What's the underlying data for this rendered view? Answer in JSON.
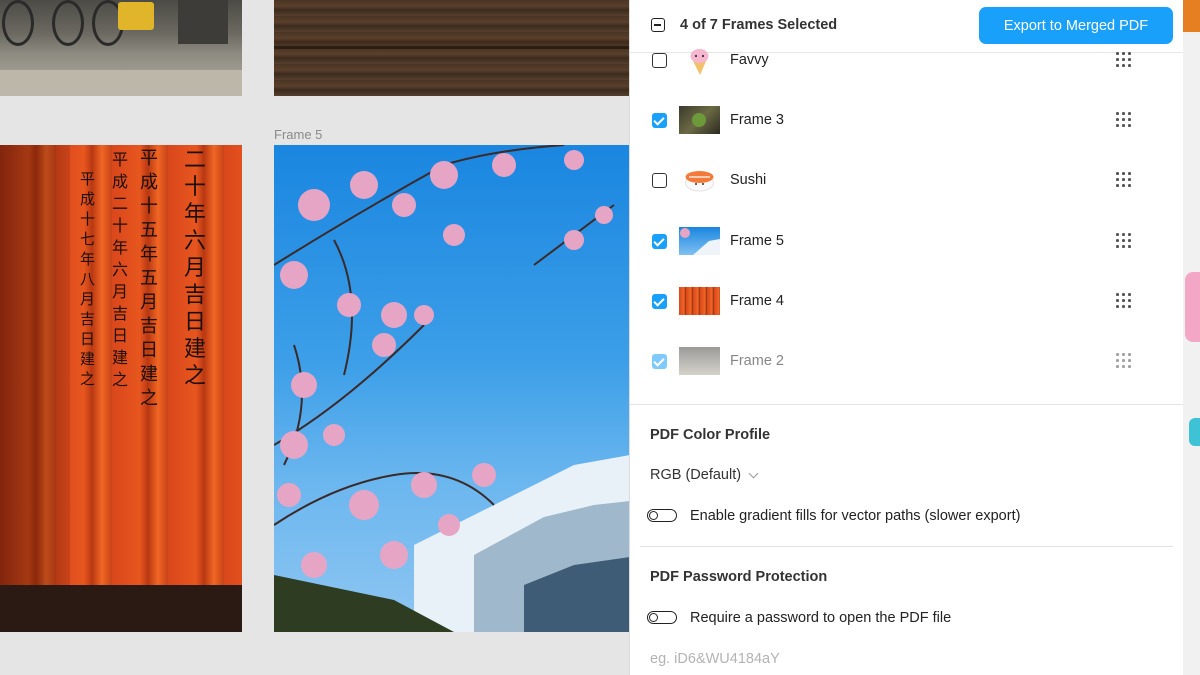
{
  "canvas": {
    "frame5_label": "Frame 5",
    "torii_columns": [
      "平成十七年八月吉日建之",
      "平成二十年六月吉日建之",
      "平成十五年五月吉日建之",
      "二十年六月吉日建之"
    ]
  },
  "panel": {
    "header": {
      "title": "4 of 7 Frames Selected",
      "export_label": "Export to Merged PDF"
    },
    "frames": [
      {
        "label": "Favvy",
        "checked": false,
        "thumb": "ice-cream-icon"
      },
      {
        "label": "Frame 3",
        "checked": true,
        "thumb": "matcha-photo"
      },
      {
        "label": "Sushi",
        "checked": false,
        "thumb": "sushi-icon"
      },
      {
        "label": "Frame 5",
        "checked": true,
        "thumb": "fuji-photo"
      },
      {
        "label": "Frame 4",
        "checked": true,
        "thumb": "torii-photo"
      },
      {
        "label": "Frame 2",
        "checked": true,
        "thumb": "street-photo"
      }
    ],
    "color_profile": {
      "title": "PDF Color Profile",
      "selected": "RGB (Default)",
      "gradient_toggle_label": "Enable gradient fills for vector paths (slower export)"
    },
    "password": {
      "title": "PDF Password Protection",
      "toggle_label": "Require a password to open the PDF file",
      "placeholder": "eg. iD6&WU4184aY"
    }
  },
  "colors": {
    "accent": "#18a0fb",
    "torii": "#e8561f",
    "sky": "#1a86e0"
  }
}
